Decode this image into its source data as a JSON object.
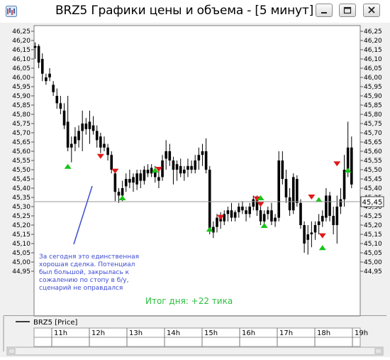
{
  "window": {
    "title": "BRZ5 Графики цены и объема - [5 минут]",
    "controls": [
      "minimize-icon",
      "restore-icon",
      "close-icon"
    ]
  },
  "chart_data": {
    "type": "candlestick",
    "title": "",
    "xlabel": "",
    "ylabel": "",
    "ylim": [
      44.92,
      46.28
    ],
    "y_ticks": [
      "46,25",
      "46,20",
      "46,15",
      "46,10",
      "46,05",
      "46,00",
      "45,95",
      "45,90",
      "45,85",
      "45,80",
      "45,75",
      "45,70",
      "45,65",
      "45,60",
      "45,55",
      "45,50",
      "45,45",
      "45,40",
      "45,35",
      "45,30",
      "45,25",
      "45,20",
      "45,15",
      "45,10",
      "45,05",
      "45,00",
      "44,95"
    ],
    "x_ticks": [
      "11h",
      "12h",
      "13h",
      "14h",
      "15h",
      "16h",
      "17h",
      "18h",
      "19h"
    ],
    "last_price": "45,45",
    "legend": "BRZ5 [Price]",
    "bars_per_hour": 12,
    "candles": [
      [
        46.16,
        46.19,
        46.1,
        46.17
      ],
      [
        46.17,
        46.18,
        46.05,
        46.08
      ],
      [
        46.1,
        46.13,
        45.98,
        46.02
      ],
      [
        45.98,
        46.02,
        45.96,
        46.0
      ],
      [
        46.02,
        46.05,
        45.98,
        46.0
      ],
      [
        45.96,
        45.98,
        45.9,
        45.92
      ],
      [
        45.9,
        45.94,
        45.83,
        45.86
      ],
      [
        45.86,
        45.9,
        45.8,
        45.83
      ],
      [
        45.82,
        45.86,
        45.72,
        45.74
      ],
      [
        45.76,
        45.9,
        45.6,
        45.62
      ],
      [
        45.62,
        45.68,
        45.54,
        45.64
      ],
      [
        45.64,
        45.73,
        45.6,
        45.68
      ],
      [
        45.66,
        45.74,
        45.62,
        45.71
      ],
      [
        45.71,
        45.82,
        45.6,
        45.75
      ],
      [
        45.75,
        45.78,
        45.69,
        45.72
      ],
      [
        45.72,
        45.82,
        45.64,
        45.76
      ],
      [
        45.74,
        45.79,
        45.69,
        45.71
      ],
      [
        45.71,
        45.74,
        45.62,
        45.66
      ],
      [
        45.68,
        45.7,
        45.59,
        45.62
      ],
      [
        45.64,
        45.68,
        45.6,
        45.62
      ],
      [
        45.62,
        45.64,
        45.55,
        45.58
      ],
      [
        45.58,
        45.6,
        45.48,
        45.5
      ],
      [
        45.48,
        45.5,
        45.33,
        45.38
      ],
      [
        45.38,
        45.4,
        45.32,
        45.36
      ],
      [
        45.36,
        45.44,
        45.33,
        45.4
      ],
      [
        45.41,
        45.48,
        45.38,
        45.45
      ],
      [
        45.45,
        45.5,
        45.4,
        45.43
      ],
      [
        45.43,
        45.48,
        45.38,
        45.46
      ],
      [
        45.42,
        45.5,
        45.39,
        45.48
      ],
      [
        45.48,
        45.5,
        45.4,
        45.44
      ],
      [
        45.44,
        45.52,
        45.42,
        45.5
      ],
      [
        45.5,
        45.53,
        45.46,
        45.48
      ],
      [
        45.48,
        45.53,
        45.46,
        45.51
      ],
      [
        45.5,
        45.52,
        45.43,
        45.46
      ],
      [
        45.46,
        45.5,
        45.4,
        45.44
      ],
      [
        45.46,
        45.58,
        45.44,
        45.55
      ],
      [
        45.56,
        45.66,
        45.5,
        45.6
      ],
      [
        45.6,
        45.64,
        45.52,
        45.55
      ],
      [
        45.55,
        45.57,
        45.42,
        45.5
      ],
      [
        45.5,
        45.55,
        45.44,
        45.53
      ],
      [
        45.52,
        45.56,
        45.46,
        45.48
      ],
      [
        45.48,
        45.52,
        45.44,
        45.5
      ],
      [
        45.5,
        45.56,
        45.46,
        45.52
      ],
      [
        45.52,
        45.55,
        45.48,
        45.5
      ],
      [
        45.5,
        45.58,
        45.48,
        45.55
      ],
      [
        45.55,
        45.62,
        45.5,
        45.58
      ],
      [
        45.58,
        45.64,
        45.52,
        45.6
      ],
      [
        45.6,
        45.67,
        45.48,
        45.5
      ],
      [
        45.5,
        45.52,
        45.15,
        45.17
      ],
      [
        45.16,
        45.22,
        45.13,
        45.19
      ],
      [
        45.19,
        45.26,
        45.16,
        45.24
      ],
      [
        45.24,
        45.27,
        45.18,
        45.22
      ],
      [
        45.22,
        45.28,
        45.2,
        45.26
      ],
      [
        45.26,
        45.3,
        45.22,
        45.28
      ],
      [
        45.28,
        45.32,
        45.22,
        45.24
      ],
      [
        45.24,
        45.28,
        45.22,
        45.27
      ],
      [
        45.27,
        45.32,
        45.24,
        45.3
      ],
      [
        45.3,
        45.33,
        45.26,
        45.28
      ],
      [
        45.28,
        45.3,
        45.22,
        45.26
      ],
      [
        45.26,
        45.32,
        45.24,
        45.3
      ],
      [
        45.3,
        45.36,
        45.28,
        45.34
      ],
      [
        45.34,
        45.36,
        45.25,
        45.28
      ],
      [
        45.28,
        45.3,
        45.2,
        45.22
      ],
      [
        45.22,
        45.28,
        45.2,
        45.26
      ],
      [
        45.26,
        45.3,
        45.23,
        45.28
      ],
      [
        45.28,
        45.32,
        45.2,
        45.22
      ],
      [
        45.22,
        45.26,
        45.19,
        45.24
      ],
      [
        45.24,
        45.6,
        45.22,
        45.55
      ],
      [
        45.55,
        45.6,
        45.42,
        45.45
      ],
      [
        45.45,
        45.5,
        45.32,
        45.35
      ],
      [
        45.35,
        45.4,
        45.25,
        45.28
      ],
      [
        45.28,
        45.48,
        45.26,
        45.46
      ],
      [
        45.45,
        45.47,
        45.3,
        45.32
      ],
      [
        45.32,
        45.34,
        45.18,
        45.2
      ],
      [
        45.2,
        45.22,
        45.05,
        45.1
      ],
      [
        45.12,
        45.2,
        45.04,
        45.15
      ],
      [
        45.15,
        45.22,
        45.08,
        45.16
      ],
      [
        45.16,
        45.22,
        45.12,
        45.2
      ],
      [
        45.2,
        45.26,
        45.15,
        45.22
      ],
      [
        45.22,
        45.28,
        45.19,
        45.25
      ],
      [
        45.24,
        45.4,
        45.22,
        45.36
      ],
      [
        45.36,
        45.38,
        45.22,
        45.25
      ],
      [
        45.25,
        45.3,
        45.15,
        45.2
      ],
      [
        45.2,
        45.36,
        45.1,
        45.3
      ],
      [
        45.3,
        45.4,
        45.26,
        45.34
      ],
      [
        45.34,
        45.58,
        45.3,
        45.5
      ],
      [
        45.5,
        45.76,
        45.46,
        45.62
      ],
      [
        45.62,
        45.68,
        45.4,
        45.42
      ]
    ],
    "signals": [
      {
        "bar": 9,
        "kind": "buy",
        "price": 45.52
      },
      {
        "bar": 18,
        "kind": "sell",
        "price": 45.57
      },
      {
        "bar": 22,
        "kind": "sell",
        "price": 45.49
      },
      {
        "bar": 24,
        "kind": "buy",
        "price": 45.35
      },
      {
        "bar": 33,
        "kind": "buy",
        "price": 45.5
      },
      {
        "bar": 34,
        "kind": "sell",
        "price": 45.5
      },
      {
        "bar": 48,
        "kind": "buy",
        "price": 45.18
      },
      {
        "bar": 51,
        "kind": "sell",
        "price": 45.24
      },
      {
        "bar": 61,
        "kind": "sell",
        "price": 45.34
      },
      {
        "bar": 62,
        "kind": "buy",
        "price": 45.35
      },
      {
        "bar": 62,
        "kind": "sell",
        "price": 45.31
      },
      {
        "bar": 63,
        "kind": "buy",
        "price": 45.2
      },
      {
        "bar": 76,
        "kind": "sell",
        "price": 45.35
      },
      {
        "bar": 78,
        "kind": "buy",
        "price": 45.34
      },
      {
        "bar": 79,
        "kind": "sell",
        "price": 45.14
      },
      {
        "bar": 79,
        "kind": "buy",
        "price": 45.08
      },
      {
        "bar": 83,
        "kind": "sell",
        "price": 45.53
      },
      {
        "bar": 86,
        "kind": "buy",
        "price": 45.5
      }
    ],
    "annotations": {
      "note": "За сегодня это единственная хорошая сделка. Потенциал был большой, закрылась к сожалению по стопу в б/у, сценарий не оправдался",
      "note_lines": [
        "За сегодня это единственная",
        "хорошая сделка. Потенциал",
        "был большой, закрылась к",
        "сожалению по стопу в б/у,",
        "сценарий не оправдался"
      ],
      "result": "Итог дня: +22 тика"
    },
    "colors": {
      "candle": "#000000",
      "buy": "#18c418",
      "sell": "#e01818",
      "note": "#3c4bd0",
      "result": "#2dbf3f"
    }
  }
}
